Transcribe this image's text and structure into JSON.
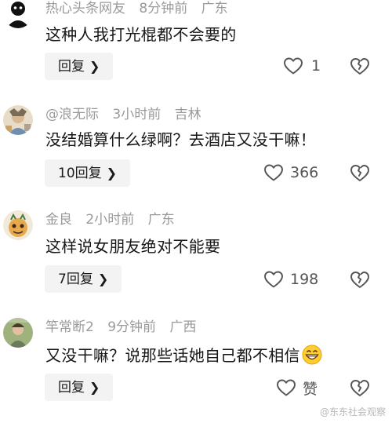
{
  "comments": [
    {
      "username": "热心头条网友",
      "time": "8分钟前",
      "location": "广东",
      "text": "这种人我打光棍都不会要的",
      "reply_label": "回复",
      "like_count": "1"
    },
    {
      "username": "@浪无际",
      "time": "3小时前",
      "location": "吉林",
      "text": "没结婚算什么绿啊？去酒店又没干嘛！",
      "reply_label": "10回复",
      "like_count": "366"
    },
    {
      "username": "金良",
      "time": "2小时前",
      "location": "广东",
      "text": "这样说女朋友绝对不能要",
      "reply_label": "7回复",
      "like_count": "198"
    },
    {
      "username": "竿常断2",
      "time": "9分钟前",
      "location": "广西",
      "text": "又没干嘛？说那些话她自己都不相信",
      "text_emoji": "grinning-face-emoji",
      "reply_label": "回复",
      "like_count": "赞"
    }
  ],
  "watermark": "@东东社会观察",
  "icons": {
    "like": "heart-outline-icon",
    "dislike": "broken-heart-icon",
    "chevron": "chevron-right-icon"
  },
  "colors": {
    "meta": "#9a9a9a",
    "text": "#161616",
    "button_bg": "#f3f3f3",
    "icon": "#555555"
  }
}
